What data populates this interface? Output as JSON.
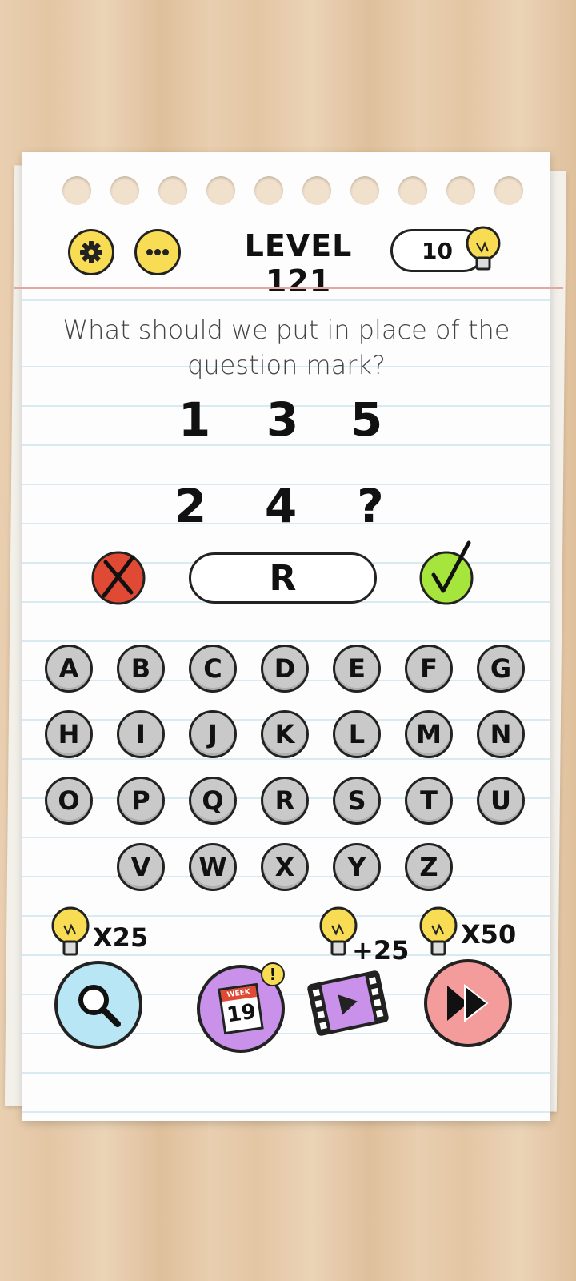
{
  "header": {
    "level_title": "LEVEL 121",
    "hints_count": "10",
    "settings_icon": "gear-icon",
    "menu_icon": "more-dots-icon",
    "hint_icon": "lightbulb-icon"
  },
  "puzzle": {
    "question": "What should we put in place of the question mark?",
    "row1": [
      "1",
      "3",
      "5"
    ],
    "row2": [
      "2",
      "4",
      "?"
    ]
  },
  "answer": {
    "value": "R",
    "clear_icon": "x-mark-icon",
    "submit_icon": "check-mark-icon"
  },
  "keyboard": {
    "rows": [
      [
        "A",
        "B",
        "C",
        "D",
        "E",
        "F",
        "G"
      ],
      [
        "H",
        "I",
        "J",
        "K",
        "L",
        "M",
        "N"
      ],
      [
        "O",
        "P",
        "Q",
        "R",
        "S",
        "T",
        "U"
      ],
      [
        "V",
        "W",
        "X",
        "Y",
        "Z"
      ]
    ]
  },
  "actions": {
    "reveal_cost": "X25",
    "reveal_icon": "magnifier-icon",
    "weekly_label": "WEEK",
    "weekly_day": "19",
    "weekly_badge": "!",
    "video_reward": "+25",
    "video_icon": "film-play-icon",
    "skip_cost": "X50",
    "skip_icon": "fast-forward-icon"
  },
  "colors": {
    "yellow": "#f7dc54",
    "red": "#e04a35",
    "green": "#a6e53c",
    "key_gray": "#c9c9c9",
    "blue": "#b8e6f4",
    "purple": "#c991ea",
    "pink": "#f49b9b"
  }
}
